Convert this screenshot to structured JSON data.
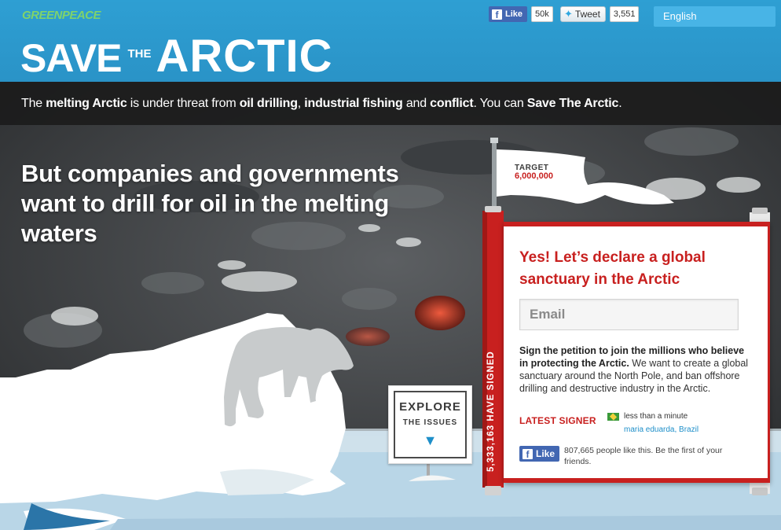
{
  "header": {
    "org_logo": "GREENPEACE",
    "title_save": "SAVE",
    "title_the": "THE",
    "title_arctic": "ARCTIC",
    "facebook": {
      "label": "Like",
      "count": "50k"
    },
    "twitter": {
      "label": "Tweet",
      "count": "3,551"
    },
    "language": "English"
  },
  "tagline": {
    "t1": "The ",
    "b1": "melting Arctic",
    "t2": " is under threat from ",
    "b2": "oil drilling",
    "t3": ", ",
    "b3": "industrial fishing",
    "t4": " and ",
    "b4": "conflict",
    "t5": ". You can ",
    "b5": "Save The Arctic",
    "t6": "."
  },
  "headline": "But companies and governments want to drill for oil in the melting waters",
  "explore": {
    "title": "EXPLORE",
    "subtitle": "THE ISSUES",
    "arrow": "▼"
  },
  "petition": {
    "target_label": "TARGET",
    "target_value": "6,000,000",
    "signed_count": "5,333,163 HAVE SIGNED",
    "heading": "Yes! Let’s declare a global sanctuary in the Arctic",
    "email_placeholder": "Email",
    "body_bold": "Sign the petition to join the millions who believe in protecting the Arctic.",
    "body_rest": " We want to create a global sanctuary around the North Pole, and ban offshore drilling and destructive industry in the Arctic.",
    "latest_label": "LATEST SIGNER",
    "latest_time": "less than a minute",
    "latest_name": "maria eduarda, Brazil",
    "fb_like_label": "Like",
    "fb_like_text": "807,665 people like this. Be the first of your friends."
  },
  "colors": {
    "header_blue": "#2e9fd3",
    "accent_red": "#c8201f",
    "link_blue": "#1e8fc9",
    "facebook_blue": "#4267b2"
  }
}
